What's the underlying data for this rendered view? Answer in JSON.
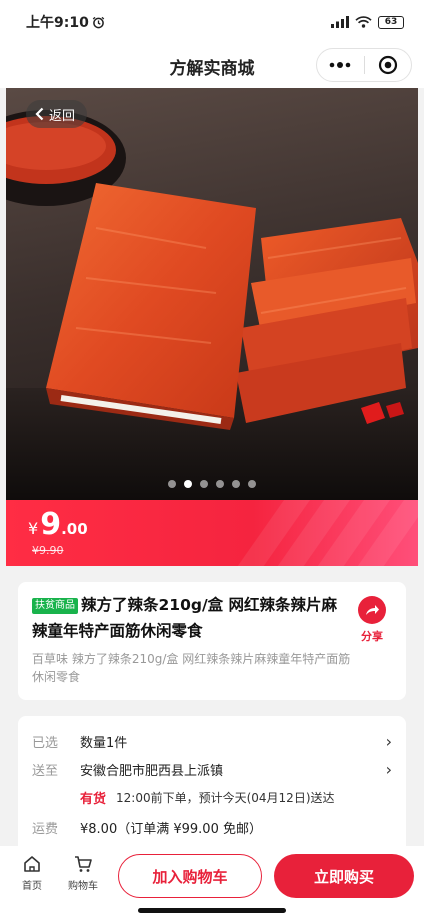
{
  "status_bar": {
    "time": "上午9:10",
    "battery": "63"
  },
  "nav": {
    "title": "方解实商城"
  },
  "hero": {
    "back_label": "返回",
    "page_count": 6,
    "active_page": 2
  },
  "price": {
    "symbol": "¥",
    "integer": "9",
    "decimal": ".00",
    "original": "¥9.90"
  },
  "product": {
    "badge": "扶贫商品",
    "title": "辣方了辣条210g/盒 网红辣条辣片麻辣童年特产面筋休闲零食",
    "subtitle": "百草味 辣方了辣条210g/盒 网红辣条辣片麻辣童年特产面筋休闲零食",
    "share_label": "分享"
  },
  "info": {
    "selected_label": "已选",
    "selected_value": "数量1件",
    "ship_label": "送至",
    "ship_value": "安徽合肥市肥西县上派镇",
    "stock": "有货",
    "delivery": "12:00前下单，预计今天(04月12日)送达",
    "freight_label": "运费",
    "freight_value": "¥8.00（订单满 ¥99.00 免邮）"
  },
  "bottom": {
    "home_label": "首页",
    "cart_label": "购物车",
    "add_cart": "加入购物车",
    "buy_now": "立即购买"
  },
  "colors": {
    "accent": "#e8213a",
    "badge": "#19b34c"
  },
  "icons": [
    "alarm-icon",
    "signal-icon",
    "wifi-icon",
    "battery-icon",
    "more-icon",
    "close-target-icon",
    "back-chevron-icon",
    "share-arrow-icon",
    "chevron-right-icon",
    "home-icon",
    "cart-icon"
  ]
}
